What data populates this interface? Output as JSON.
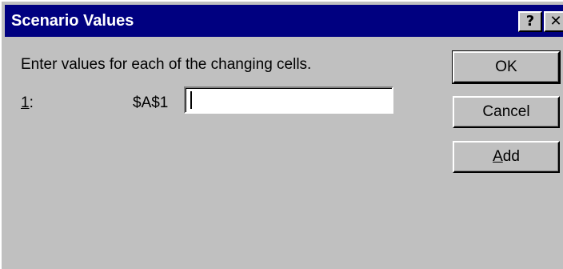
{
  "window": {
    "title": "Scenario Values",
    "help_label": "?",
    "close_label": "✕"
  },
  "form": {
    "prompt": "Enter values for each of the changing cells.",
    "rows": [
      {
        "number_prefix": "1",
        "number_suffix": ":",
        "cell_ref": "$A$1",
        "value": ""
      }
    ]
  },
  "buttons": {
    "ok_label": "OK",
    "cancel_label": "Cancel",
    "add_first": "A",
    "add_rest": "dd"
  }
}
